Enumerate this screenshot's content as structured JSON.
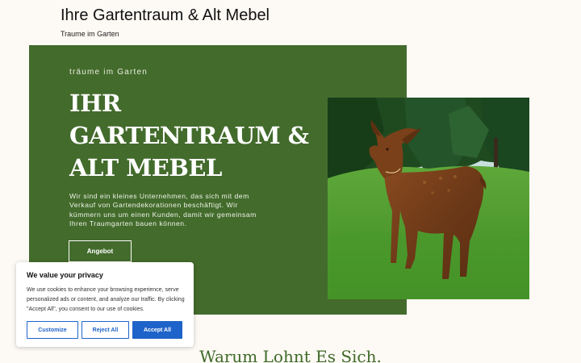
{
  "header": {
    "site_title": "Ihre Gartentraum & Alt Mebel",
    "tagline": "Traume im Garten"
  },
  "hero": {
    "eyebrow": "träume im Garten",
    "heading_lines": [
      "IHR",
      "GARTENTRAUM &",
      "ALT MEBEL"
    ],
    "description": "Wir sind ein kleines Unternehmen, das sich mit dem Verkauf von Gartendekorationen beschäftigt. Wir kümmern uns um einen Kunden, damit wir gemeinsam Ihren Traumgarten bauen können.",
    "button_label": "Angebot",
    "panel_color": "#436b2c",
    "image": "rusty-metal-deer-garden-decoration"
  },
  "section": {
    "heading": "Warum Lohnt Es Sich."
  },
  "cookie_banner": {
    "title": "We value your privacy",
    "text": "We use cookies to enhance your browsing experience, serve personalized ads or content, and analyze our traffic. By clicking \"Accept All\", you consent to our use of cookies.",
    "buttons": {
      "customize": "Customize",
      "reject": "Reject All",
      "accept": "Accept All"
    },
    "accent_color": "#1e63c9"
  }
}
